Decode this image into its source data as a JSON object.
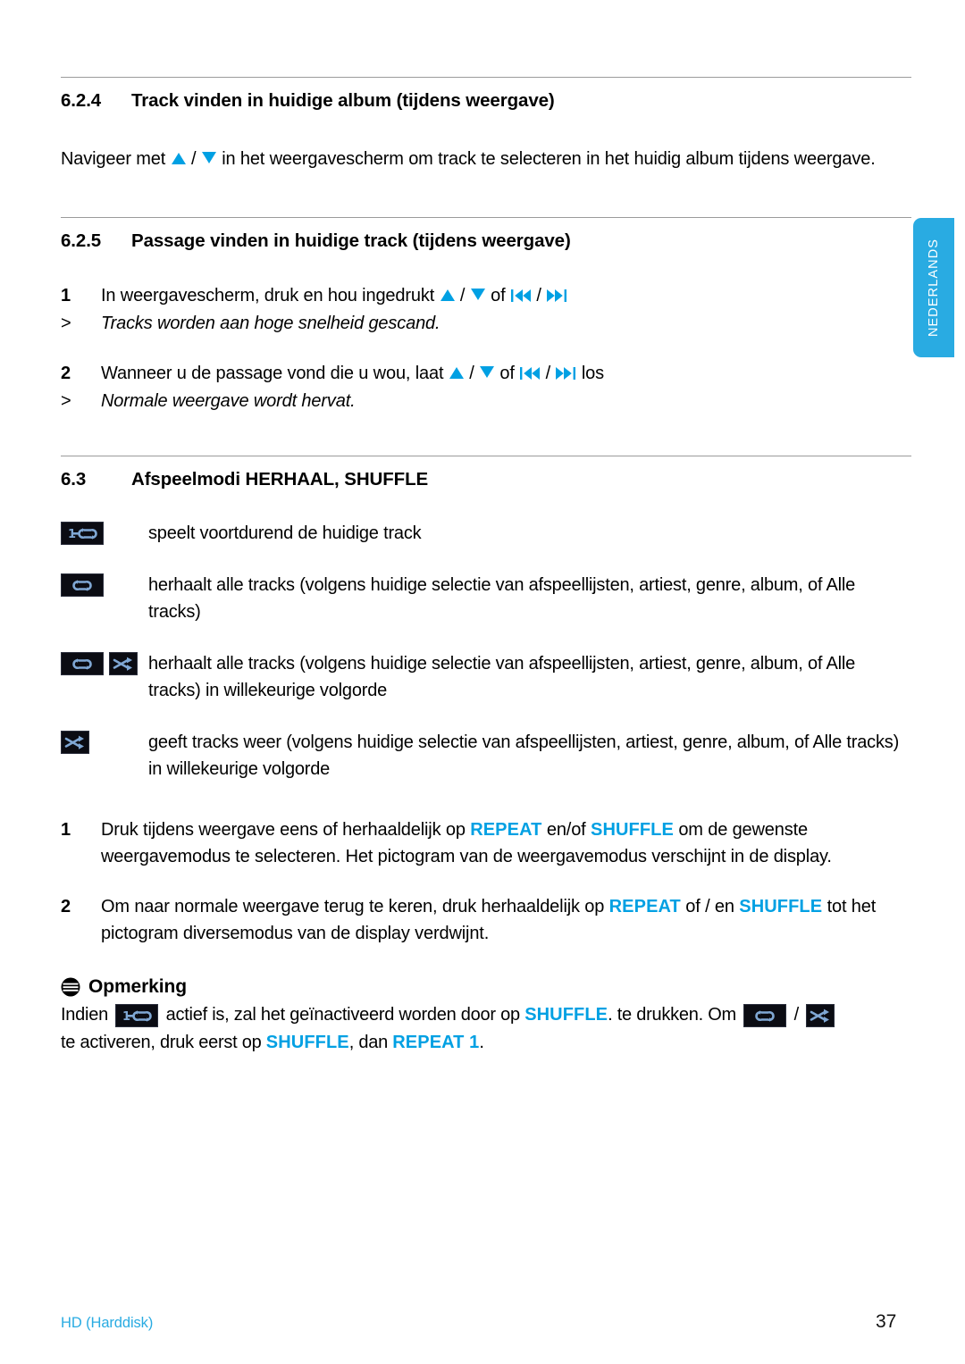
{
  "page": {
    "language_tab": "NEDERLANDS",
    "accent_blue": "#00A0E3",
    "tab_blue": "#29ABE2",
    "rule_gray": "#9b9b9b"
  },
  "sections": [
    {
      "number": "6.2.4",
      "title": "Track vinden in huidige album (tijdens weergave)",
      "paragraph_before_icons": "Navigeer met ",
      "paragraph_mid": " / ",
      "paragraph_after_icons": " in het weergavescherm om track te selecteren in het huidig album tijdens weergave."
    },
    {
      "number": "6.2.5",
      "title": "Passage vinden in huidige track (tijdens weergave)",
      "steps": [
        {
          "marker": "1",
          "text_a": "In weergavescherm, druk en hou ingedrukt ",
          "text_b": " / ",
          "text_c": " of ",
          "text_d": " / ",
          "text_e": ""
        },
        {
          "marker": ">",
          "italic": "Tracks worden aan hoge snelheid gescand."
        },
        {
          "marker": "2",
          "text_a": "Wanneer u de passage vond die u wou, laat ",
          "text_b": " / ",
          "text_c": " of ",
          "text_d": " / ",
          "text_e": " los"
        },
        {
          "marker": ">",
          "italic": "Normale weergave wordt hervat."
        }
      ]
    },
    {
      "number": "6.3",
      "title_plain": "Afspeelmodi ",
      "title_bold": "HERHAAL, SHUFFLE"
    }
  ],
  "modes": [
    {
      "icons": [
        "repeat-one-icon"
      ],
      "text": "speelt voortdurend de huidige track"
    },
    {
      "icons": [
        "repeat-all-icon"
      ],
      "text": "herhaalt alle tracks (volgens huidige selectie van afspeellijsten, artiest, genre, album, of Alle tracks)"
    },
    {
      "icons": [
        "repeat-all-icon",
        "shuffle-icon"
      ],
      "text": "herhaalt alle tracks (volgens huidige selectie van afspeellijsten, artiest, genre, album, of Alle tracks) in willekeurige volgorde"
    },
    {
      "icons": [
        "shuffle-icon"
      ],
      "text": "geeft tracks weer (volgens huidige selectie van afspeellijsten, artiest, genre, album, of Alle tracks) in willekeurige volgorde"
    }
  ],
  "mode_steps": [
    {
      "marker": "1",
      "part_1": "Druk tijdens weergave eens of herhaaldelijk op ",
      "key_1": "REPEAT",
      "part_2": " en/of ",
      "key_2": "SHUFFLE",
      "part_3": " om de gewenste weergavemodus te selecteren. Het pictogram van de weergavemodus verschijnt in de display."
    },
    {
      "marker": "2",
      "part_1": "Om naar normale weergave terug te keren, druk herhaaldelijk op ",
      "key_1": "REPEAT",
      "part_2": " of / en ",
      "key_2": "SHUFFLE",
      "part_3": " tot het pictogram diversemodus van de display verdwijnt."
    }
  ],
  "note": {
    "icon": "note-icon",
    "heading": "Opmerking",
    "line1_a": "Indien ",
    "line1_b": " actief is, zal het geïnactiveerd worden door op ",
    "line1_key": "SHUFFLE",
    "line1_c": ". te drukken. Om ",
    "line1_sep": " / ",
    "line2_a": "te activeren, druk eerst op ",
    "line2_key1": "SHUFFLE",
    "line2_b": ", dan ",
    "line2_key2": "REPEAT 1",
    "line2_c": "."
  },
  "footer": {
    "left": "HD (Harddisk)",
    "page_number": "37"
  }
}
